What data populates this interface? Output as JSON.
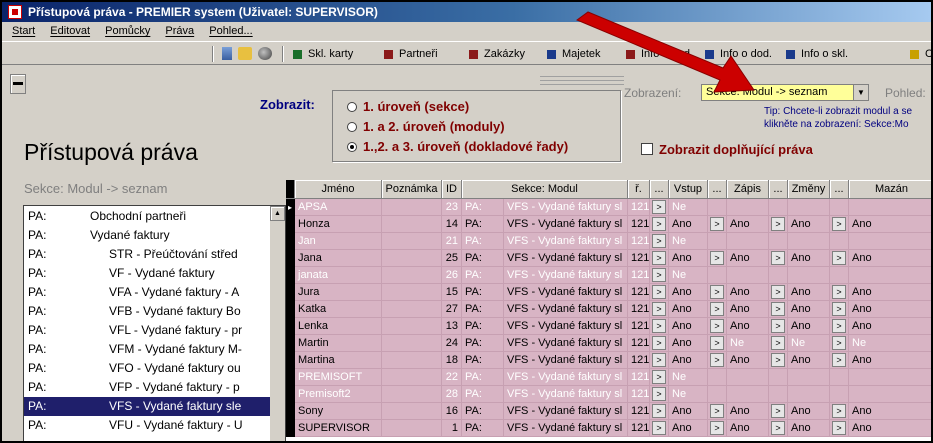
{
  "window": {
    "title": "Přístupová práva - PREMIER system (Uživatel: SUPERVISOR)"
  },
  "menu": [
    "Start",
    "Editovat",
    "Pomůcky",
    "Práva",
    "Pohled..."
  ],
  "toolbar": {
    "buttons": [
      {
        "label": "Skl. karty",
        "color": "#1a6f2a"
      },
      {
        "label": "Partneři",
        "color": "#8b1a1a"
      },
      {
        "label": "Zakázky",
        "color": "#8b1a1a"
      },
      {
        "label": "Majetek",
        "color": "#1a3a8b"
      },
      {
        "label": "Info o dod.",
        "color": "#8b1a1a"
      },
      {
        "label": "Info o dod.",
        "color": "#1a3a8b"
      },
      {
        "label": "Info o skl.",
        "color": "#1a3a8b"
      },
      {
        "label": "C",
        "color": "#c8a000"
      }
    ]
  },
  "filter": {
    "zobrazit_label": "Zobrazit:",
    "options": [
      {
        "label": "1. úroveň (sekce)",
        "selected": false
      },
      {
        "label": "1. a 2. úroveň (moduly)",
        "selected": false
      },
      {
        "label": "1.,2. a 3. úroveň (dokladové řady)",
        "selected": true
      }
    ],
    "extra_rights_label": "Zobrazit doplňující práva",
    "extra_rights_checked": false
  },
  "view": {
    "zobrazeni_label": "Zobrazení:",
    "zobrazeni_value": "Sekce: Modul -> seznam",
    "pohled_label": "Pohled:",
    "tip_line1": "Tip: Chcete-li zobrazit modul a se",
    "tip_line2": "klikněte na zobrazení: Sekce:Mo"
  },
  "page_title": "Přístupová práva",
  "section_label": "Sekce: Modul -> seznam",
  "left_list": [
    {
      "prefix": "PA:",
      "name": "Obchodní partneři",
      "indent": 0,
      "selected": false
    },
    {
      "prefix": "PA:",
      "name": "Vydané faktury",
      "indent": 0,
      "selected": false
    },
    {
      "prefix": "PA:",
      "name": "STR - Přeúčtování střed",
      "indent": 1,
      "selected": false
    },
    {
      "prefix": "PA:",
      "name": "VF  - Vydané faktury",
      "indent": 1,
      "selected": false
    },
    {
      "prefix": "PA:",
      "name": "VFA - Vydané faktury - A",
      "indent": 1,
      "selected": false
    },
    {
      "prefix": "PA:",
      "name": "VFB - Vydané faktury Bo",
      "indent": 1,
      "selected": false
    },
    {
      "prefix": "PA:",
      "name": "VFL - Vydané faktury - pr",
      "indent": 1,
      "selected": false
    },
    {
      "prefix": "PA:",
      "name": "VFM - Vydané faktury M-",
      "indent": 1,
      "selected": false
    },
    {
      "prefix": "PA:",
      "name": "VFO - Vydané faktury ou",
      "indent": 1,
      "selected": false
    },
    {
      "prefix": "PA:",
      "name": "VFP - Vydané faktury - p",
      "indent": 1,
      "selected": false
    },
    {
      "prefix": "PA:",
      "name": "VFS - Vydané faktury sle",
      "indent": 1,
      "selected": true
    },
    {
      "prefix": "PA:",
      "name": "VFU - Vydané faktury - U",
      "indent": 1,
      "selected": false
    }
  ],
  "grid": {
    "columns": [
      "Jméno",
      "Poznámka",
      "ID",
      "Sekce: Modul",
      "ř.",
      "...",
      "Vstup",
      "...",
      "Zápis",
      "...",
      "Změny",
      "...",
      "Mazán"
    ],
    "btn_glyph": ">",
    "rows": [
      {
        "name": "APSA",
        "note": "",
        "id": "23",
        "sekce": "PA:",
        "modul": "VFS - Vydané faktury sl",
        "r": "121",
        "vstup": "Ne",
        "zapis": "",
        "zmeny": "",
        "mazani": "",
        "dim": true
      },
      {
        "name": "Honza",
        "note": "",
        "id": "14",
        "sekce": "PA:",
        "modul": "VFS - Vydané faktury sl",
        "r": "121",
        "vstup": "Ano",
        "zapis": "Ano",
        "zmeny": "Ano",
        "mazani": "Ano",
        "dim": false
      },
      {
        "name": "Jan",
        "note": "",
        "id": "21",
        "sekce": "PA:",
        "modul": "VFS - Vydané faktury sl",
        "r": "121",
        "vstup": "Ne",
        "zapis": "",
        "zmeny": "",
        "mazani": "",
        "dim": true
      },
      {
        "name": "Jana",
        "note": "",
        "id": "25",
        "sekce": "PA:",
        "modul": "VFS - Vydané faktury sl",
        "r": "121",
        "vstup": "Ano",
        "zapis": "Ano",
        "zmeny": "Ano",
        "mazani": "Ano",
        "dim": false
      },
      {
        "name": "janata",
        "note": "",
        "id": "26",
        "sekce": "PA:",
        "modul": "VFS - Vydané faktury sl",
        "r": "121",
        "vstup": "Ne",
        "zapis": "",
        "zmeny": "",
        "mazani": "",
        "dim": true
      },
      {
        "name": "Jura",
        "note": "",
        "id": "15",
        "sekce": "PA:",
        "modul": "VFS - Vydané faktury sl",
        "r": "121",
        "vstup": "Ano",
        "zapis": "Ano",
        "zmeny": "Ano",
        "mazani": "Ano",
        "dim": false
      },
      {
        "name": "Katka",
        "note": "",
        "id": "27",
        "sekce": "PA:",
        "modul": "VFS - Vydané faktury sl",
        "r": "121",
        "vstup": "Ano",
        "zapis": "Ano",
        "zmeny": "Ano",
        "mazani": "Ano",
        "dim": false
      },
      {
        "name": "Lenka",
        "note": "",
        "id": "13",
        "sekce": "PA:",
        "modul": "VFS - Vydané faktury sl",
        "r": "121",
        "vstup": "Ano",
        "zapis": "Ano",
        "zmeny": "Ano",
        "mazani": "Ano",
        "dim": false
      },
      {
        "name": "Martin",
        "note": "",
        "id": "24",
        "sekce": "PA:",
        "modul": "VFS - Vydané faktury sl",
        "r": "121",
        "vstup": "Ano",
        "zapis": "Ne",
        "zmeny": "Ne",
        "mazani": "Ne",
        "dim": false,
        "dim_from": "zapis"
      },
      {
        "name": "Martina",
        "note": "",
        "id": "18",
        "sekce": "PA:",
        "modul": "VFS - Vydané faktury sl",
        "r": "121",
        "vstup": "Ano",
        "zapis": "Ano",
        "zmeny": "Ano",
        "mazani": "Ano",
        "dim": false
      },
      {
        "name": "PREMISOFT",
        "note": "",
        "id": "22",
        "sekce": "PA:",
        "modul": "VFS - Vydané faktury sl",
        "r": "121",
        "vstup": "Ne",
        "zapis": "",
        "zmeny": "",
        "mazani": "",
        "dim": true
      },
      {
        "name": "Premisoft2",
        "note": "",
        "id": "28",
        "sekce": "PA:",
        "modul": "VFS - Vydané faktury sl",
        "r": "121",
        "vstup": "Ne",
        "zapis": "",
        "zmeny": "",
        "mazani": "",
        "dim": true
      },
      {
        "name": "Sony",
        "note": "",
        "id": "16",
        "sekce": "PA:",
        "modul": "VFS - Vydané faktury sl",
        "r": "121",
        "vstup": "Ano",
        "zapis": "Ano",
        "zmeny": "Ano",
        "mazani": "Ano",
        "dim": false
      },
      {
        "name": "SUPERVISOR",
        "note": "",
        "id": "1",
        "sekce": "PA:",
        "modul": "VFS - Vydané faktury sl",
        "r": "121",
        "vstup": "Ano",
        "zapis": "Ano",
        "zmeny": "Ano",
        "mazani": "Ano",
        "dim": false
      }
    ]
  },
  "colors": {
    "grid_row": "#d8b4c4",
    "selection": "#1f1f6b",
    "combo": "#ffff99",
    "arrow": "#cc0000"
  }
}
